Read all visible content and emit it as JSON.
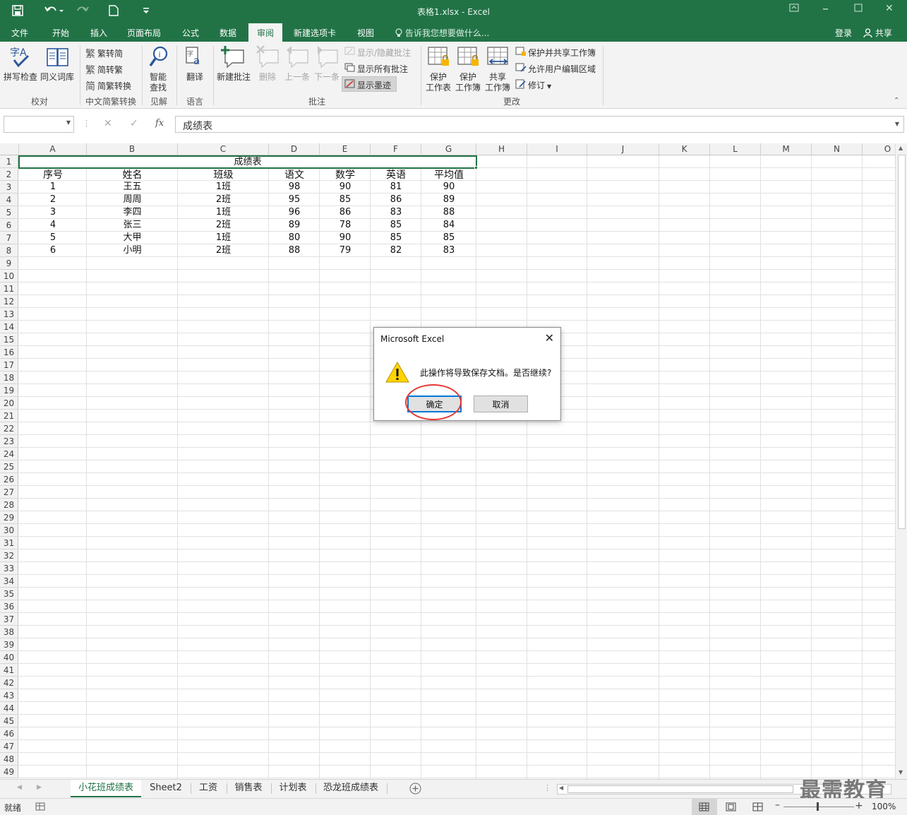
{
  "window": {
    "title": "表格1.xlsx - Excel",
    "login": "登录",
    "share": "共享"
  },
  "tabs": [
    {
      "label": "文件"
    },
    {
      "label": "开始"
    },
    {
      "label": "插入"
    },
    {
      "label": "页面布局"
    },
    {
      "label": "公式"
    },
    {
      "label": "数据"
    },
    {
      "label": "审阅",
      "active": true
    },
    {
      "label": "新建选项卡"
    },
    {
      "label": "视图"
    }
  ],
  "tell_me": "告诉我您想要做什么...",
  "ribbon": {
    "proofing": {
      "spell": "拼写检查",
      "thesaurus": "同义词库",
      "label": "校对"
    },
    "chinese": {
      "t2s": "繁转简",
      "s2t": "简转繁",
      "convert": "简繁转换",
      "label": "中文简繁转换"
    },
    "insights": {
      "smart1": "智能",
      "smart2": "查找",
      "label": "见解"
    },
    "language": {
      "translate": "翻译",
      "label": "语言"
    },
    "comments": {
      "new": "新建批注",
      "delete": "删除",
      "prev": "上一条",
      "next": "下一条",
      "toggle": "显示/隐藏批注",
      "show_all": "显示所有批注",
      "ink": "显示墨迹",
      "label": "批注"
    },
    "changes": {
      "protect_sheet1": "保护",
      "protect_sheet2": "工作表",
      "protect_wb1": "保护",
      "protect_wb2": "工作簿",
      "share_wb1": "共享",
      "share_wb2": "工作簿",
      "protect_share": "保护并共享工作簿",
      "allow_edit": "允许用户编辑区域",
      "track": "修订",
      "label": "更改"
    }
  },
  "formula_bar": {
    "fx": "fx",
    "value": "成绩表"
  },
  "columns": [
    "A",
    "B",
    "C",
    "D",
    "E",
    "F",
    "G",
    "H",
    "I",
    "J",
    "K",
    "L",
    "M",
    "N",
    "O"
  ],
  "rows": [
    "1",
    "2",
    "3",
    "4",
    "5",
    "6",
    "7",
    "8",
    "9",
    "10",
    "11",
    "12",
    "13",
    "14",
    "15",
    "16",
    "17",
    "18",
    "19",
    "20",
    "21",
    "22",
    "23",
    "24",
    "25",
    "26",
    "27",
    "28",
    "29",
    "30",
    "31",
    "32",
    "33",
    "34",
    "35",
    "36",
    "37",
    "38",
    "39",
    "40",
    "41",
    "42",
    "43",
    "44",
    "45",
    "46",
    "47",
    "48",
    "49"
  ],
  "sheet": {
    "title": "成绩表",
    "headers": [
      "序号",
      "姓名",
      "班级",
      "语文",
      "数学",
      "英语",
      "平均值"
    ],
    "data": [
      [
        "1",
        "王五",
        "1班",
        "98",
        "90",
        "81",
        "90"
      ],
      [
        "2",
        "周周",
        "2班",
        "95",
        "85",
        "86",
        "89"
      ],
      [
        "3",
        "李四",
        "1班",
        "96",
        "86",
        "83",
        "88"
      ],
      [
        "4",
        "张三",
        "2班",
        "89",
        "78",
        "85",
        "84"
      ],
      [
        "5",
        "大甲",
        "1班",
        "80",
        "90",
        "85",
        "85"
      ],
      [
        "6",
        "小明",
        "2班",
        "88",
        "79",
        "82",
        "83"
      ]
    ]
  },
  "sheet_tabs": [
    {
      "label": "小花班成绩表",
      "active": true
    },
    {
      "label": "Sheet2"
    },
    {
      "label": "工资"
    },
    {
      "label": "销售表"
    },
    {
      "label": "计划表"
    },
    {
      "label": "恐龙班成绩表"
    }
  ],
  "status": {
    "ready": "就绪",
    "zoom": "100%"
  },
  "watermark": "最需教育",
  "dialog": {
    "title": "Microsoft Excel",
    "message": "此操作将导致保存文档。是否继续?",
    "ok": "确定",
    "cancel": "取消"
  },
  "colors": {
    "brand": "#217346",
    "highlight": "#e53935",
    "focus": "#0078d7"
  }
}
